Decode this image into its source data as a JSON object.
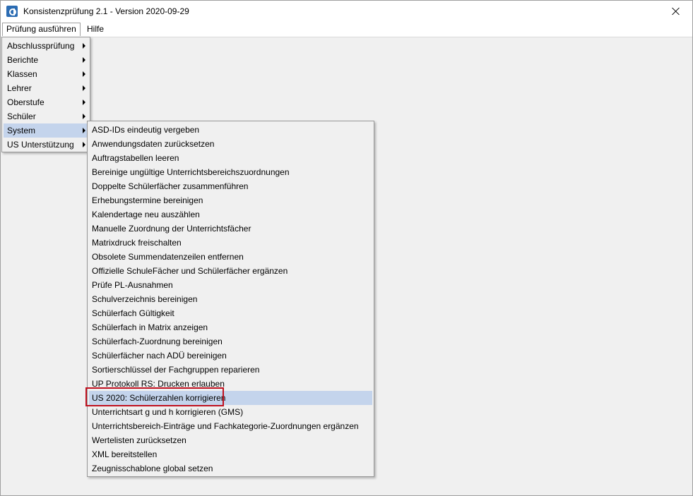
{
  "window": {
    "title": "Konsistenzprüfung 2.1 - Version 2020-09-29",
    "app_icon": "app-logo-icon",
    "close_icon": "close-icon"
  },
  "menubar": {
    "items": [
      "Prüfung ausführen",
      "Hilfe"
    ]
  },
  "main_menu": {
    "items": [
      "Abschlussprüfung",
      "Berichte",
      "Klassen",
      "Lehrer",
      "Oberstufe",
      "Schüler",
      "System",
      "US Unterstützung"
    ],
    "selected": "System"
  },
  "system_submenu": {
    "items": [
      "ASD-IDs eindeutig vergeben",
      "Anwendungsdaten zurücksetzen",
      "Auftragstabellen leeren",
      "Bereinige ungültige Unterrichtsbereichszuordnungen",
      "Doppelte Schülerfächer zusammenführen",
      "Erhebungstermine bereinigen",
      "Kalendertage neu auszählen",
      "Manuelle Zuordnung der Unterrichtsfächer",
      "Matrixdruck freischalten",
      "Obsolete Summendatenzeilen entfernen",
      "Offizielle SchuleFächer und Schülerfächer ergänzen",
      "Prüfe PL-Ausnahmen",
      "Schulverzeichnis bereinigen",
      "Schülerfach Gültigkeit",
      "Schülerfach in Matrix anzeigen",
      "Schülerfach-Zuordnung bereinigen",
      "Schülerfächer nach ADÜ bereinigen",
      "Sortierschlüssel der Fachgruppen reparieren",
      "UP Protokoll RS: Drucken erlauben",
      "US 2020: Schülerzahlen korrigieren",
      "Unterrichtsart g und h korrigieren (GMS)",
      "Unterrichtsbereich-Einträge und Fachkategorie-Zuordnungen ergänzen",
      "Wertelisten zurücksetzen",
      "XML bereitstellen",
      "Zeugnisschablone global setzen"
    ],
    "selected": "US 2020: Schülerzahlen korrigieren"
  },
  "colors": {
    "highlight": "#c4d4ec",
    "annotation_border": "#c0111f"
  }
}
